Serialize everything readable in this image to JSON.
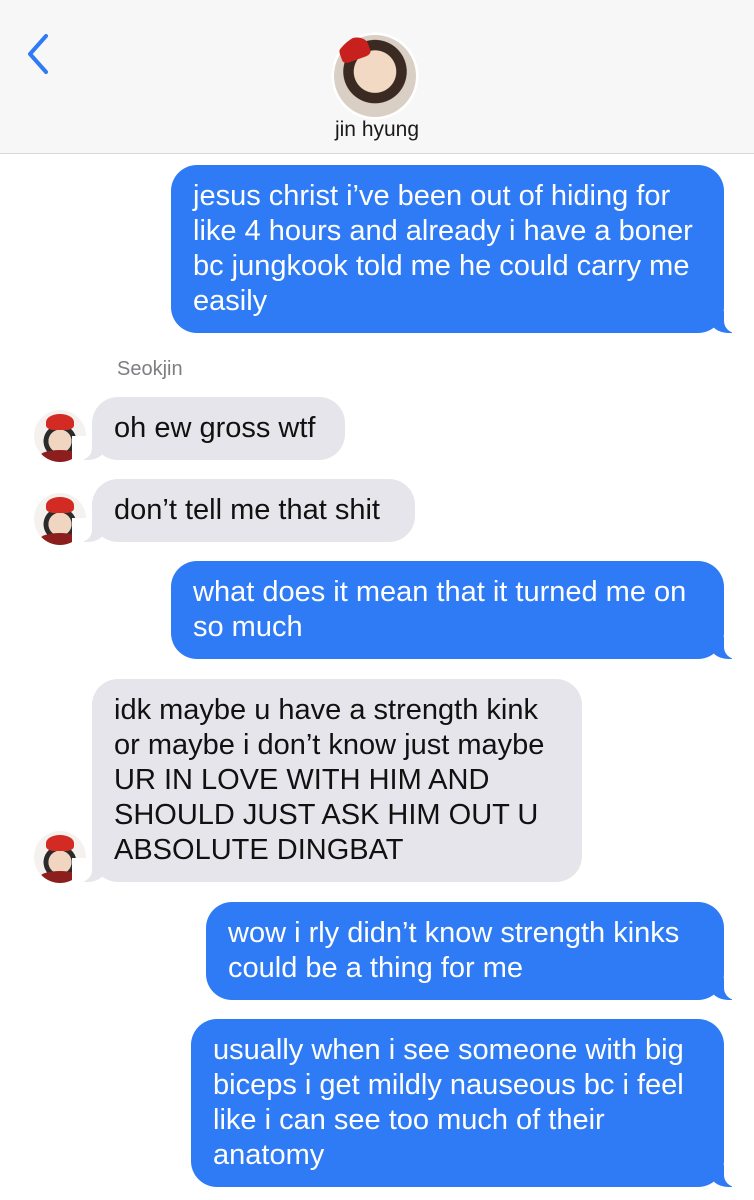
{
  "header": {
    "back_icon": "chevron-left-icon",
    "contact_name": "jin hyung",
    "accent_color": "#2f7bf6"
  },
  "sender_label": "Seokjin",
  "messages": [
    {
      "from": "me",
      "text": "jesus christ i’ve been out of hiding for like 4 hours and already i have a boner bc jungkook told me he could carry me easily"
    },
    {
      "from": "Seokjin",
      "text": "oh ew gross wtf"
    },
    {
      "from": "Seokjin",
      "text": "don’t tell me that shit"
    },
    {
      "from": "me",
      "text": "what does it mean that it turned me on so much"
    },
    {
      "from": "Seokjin",
      "text": "idk maybe u have a strength kink or maybe i don’t know just maybe UR IN LOVE WITH HIM AND SHOULD JUST ASK HIM OUT U ABSOLUTE DINGBAT"
    },
    {
      "from": "me",
      "text": "wow i rly didn’t know strength kinks could be a thing for me"
    },
    {
      "from": "me",
      "text": "usually when i see someone with big biceps i get mildly nauseous bc i feel like i can see too much of their anatomy"
    }
  ],
  "colors": {
    "sent_bubble": "#2f7bf6",
    "received_bubble": "#e6e5eb",
    "header_bg": "#f7f7f7"
  }
}
